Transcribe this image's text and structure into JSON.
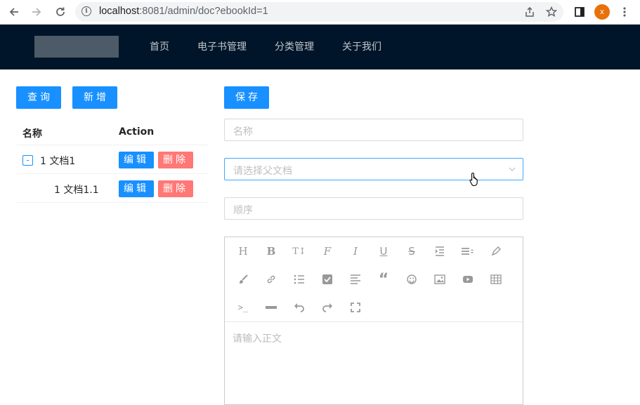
{
  "browser": {
    "url_host": "localhost",
    "url_rest": ":8081/admin/doc?ebookId=1",
    "profile_initial": "x"
  },
  "header": {
    "menu": [
      {
        "label": "首页"
      },
      {
        "label": "电子书管理"
      },
      {
        "label": "分类管理"
      },
      {
        "label": "关于我们"
      }
    ]
  },
  "left": {
    "query_label": "查询",
    "add_label": "新增",
    "table": {
      "col_name": "名称",
      "col_action": "Action",
      "rows": [
        {
          "name": "1 文档1",
          "edit": "编辑",
          "delete": "删除",
          "expand": "-"
        },
        {
          "name": "1 文档1.1",
          "edit": "编辑",
          "delete": "删除"
        }
      ]
    }
  },
  "form": {
    "save_label": "保存",
    "name_placeholder": "名称",
    "parent_placeholder": "请选择父文档",
    "order_placeholder": "顺序",
    "content_placeholder": "请输入正文"
  },
  "colors": {
    "header_bg": "#001529",
    "primary": "#1890ff",
    "danger": "#ff7875"
  }
}
